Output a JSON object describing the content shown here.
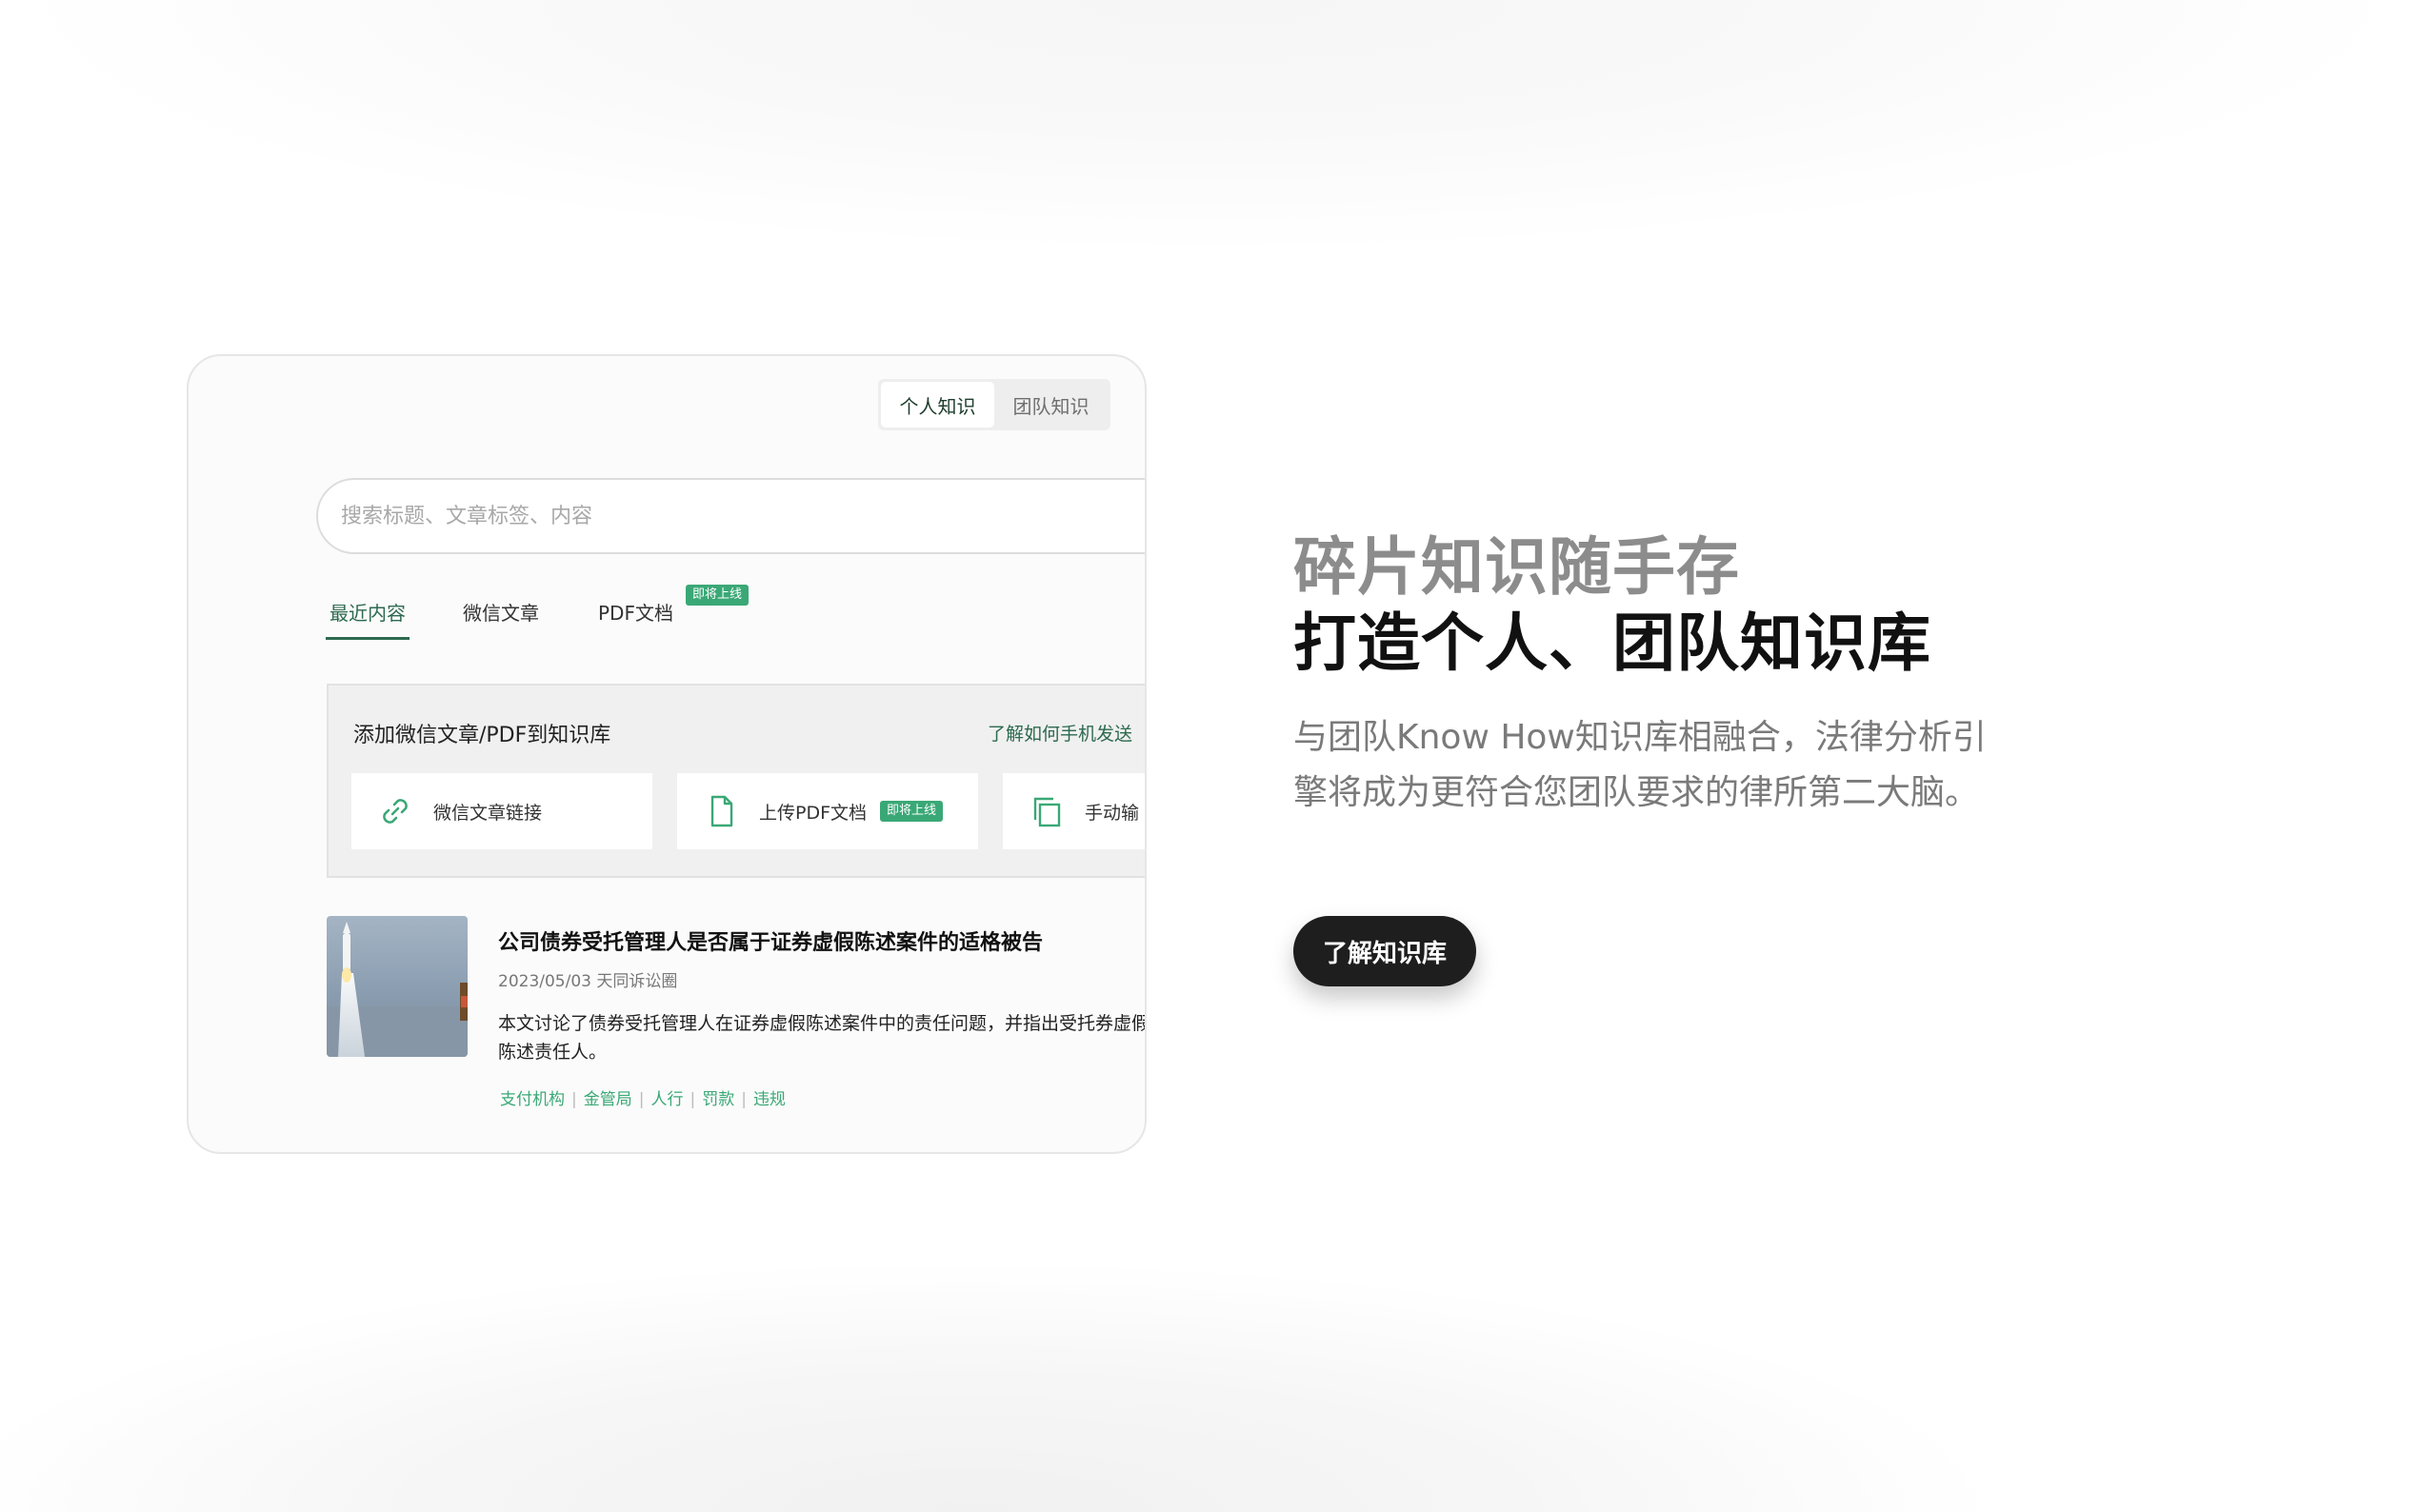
{
  "mockup": {
    "segment": {
      "personal": "个人知识",
      "team": "团队知识"
    },
    "search": {
      "placeholder": "搜索标题、文章标签、内容"
    },
    "tabs": {
      "recent": "最近内容",
      "wechat": "微信文章",
      "pdf": "PDF文档",
      "pdf_badge": "即将上线"
    },
    "add_panel": {
      "title": "添加微信文章/PDF到知识库",
      "help_link": "了解如何手机发送",
      "options": {
        "wechat_link": "微信文章链接",
        "upload_pdf": "上传PDF文档",
        "upload_pdf_badge": "即将上线",
        "manual": "手动输"
      }
    },
    "article": {
      "title": "公司债券受托管理人是否属于证券虚假陈述案件的适格被告",
      "meta": "2023/05/03 天同诉讼圈",
      "desc": "本文讨论了债券受托管理人在证券虚假陈述案件中的责任问题，并指出受托券虚假陈述责任人。",
      "tags": [
        "支付机构",
        "金管局",
        "人行",
        "罚款",
        "违规"
      ]
    }
  },
  "hero": {
    "line1": "碎片知识随手存",
    "line2": "打造个人、团队知识库",
    "description": "与团队Know How知识库相融合，法律分析引擎将成为更符合您团队要求的律所第二大脑。",
    "cta": "了解知识库"
  },
  "colors": {
    "accent_green": "#2d6a4f",
    "badge_green": "#3aa876",
    "cta_bg": "#1e1e1e",
    "headline_gray": "#8c8c8c"
  },
  "icons": [
    "link-icon",
    "document-icon",
    "copy-icon"
  ]
}
